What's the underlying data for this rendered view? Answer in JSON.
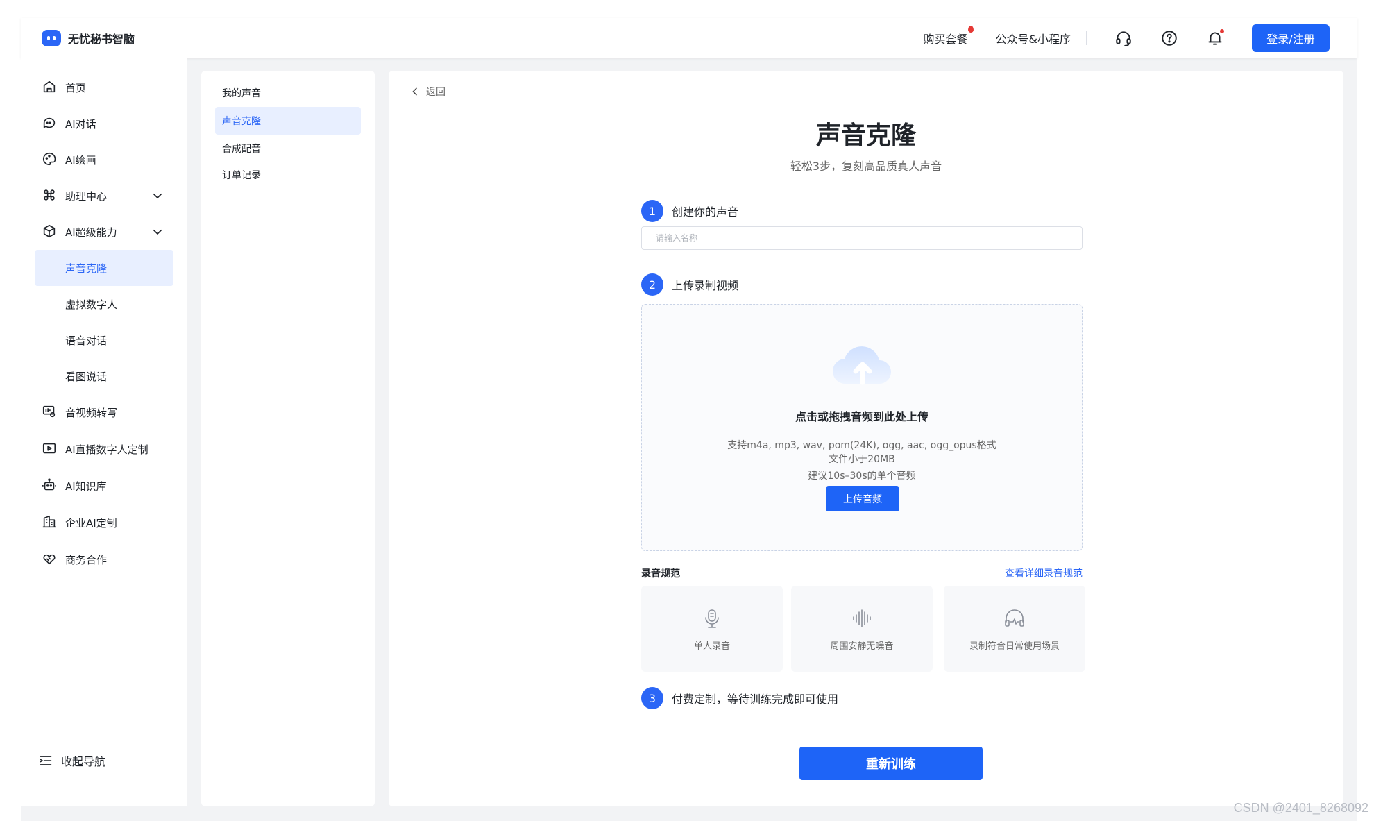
{
  "header": {
    "brand": "无忧秘书智脑",
    "links": [
      "购买套餐",
      "公众号&小程序"
    ],
    "login_label": "登录/注册"
  },
  "sidebar": {
    "items": [
      {
        "label": "首页",
        "icon": "home-icon"
      },
      {
        "label": "AI对话",
        "icon": "chat-icon"
      },
      {
        "label": "AI绘画",
        "icon": "palette-icon"
      },
      {
        "label": "助理中心",
        "icon": "command-icon"
      },
      {
        "label": "AI超级能力",
        "icon": "cube-icon"
      },
      {
        "label": "音视频转写",
        "icon": "transcribe-icon"
      },
      {
        "label": "AI直播数字人定制",
        "icon": "live-video-icon"
      },
      {
        "label": "AI知识库",
        "icon": "robot-icon"
      },
      {
        "label": "企业AI定制",
        "icon": "building-icon"
      },
      {
        "label": "商务合作",
        "icon": "handshake-icon"
      }
    ],
    "sub_items": [
      "声音克隆",
      "虚拟数字人",
      "语音对话",
      "看图说话"
    ],
    "collapse_label": "收起导航"
  },
  "subnav": {
    "items": [
      "我的声音",
      "声音克隆",
      "合成配音",
      "订单记录"
    ]
  },
  "main": {
    "back_label": "返回",
    "title": "声音克隆",
    "subtitle": "轻松3步，复刻高品质真人声音",
    "steps": [
      {
        "num": "1",
        "label": "创建你的声音"
      },
      {
        "num": "2",
        "label": "上传录制视频"
      },
      {
        "num": "3",
        "label": "付费定制，等待训练完成即可使用"
      }
    ],
    "name_placeholder": "请输入名称",
    "upload": {
      "title": "点击或拖拽音频到此处上传",
      "formats": "支持m4a, mp3, wav, pom(24K), ogg, aac, ogg_opus格式",
      "size": "文件小于20MB",
      "duration": "建议10s–30s的单个音频",
      "button": "上传音频"
    },
    "spec": {
      "label": "录音规范",
      "link": "查看详细录音规范",
      "cards": [
        {
          "label": "单人录音",
          "icon": "microphone-icon"
        },
        {
          "label": "周围安静无噪音",
          "icon": "sound-wave-icon"
        },
        {
          "label": "录制符合日常使用场景",
          "icon": "headphones-icon"
        }
      ]
    },
    "retrain_label": "重新训练"
  },
  "watermark": "CSDN @2401_8268092",
  "colors": {
    "accent": "#1e64f7",
    "active_bg": "#e8efff",
    "page_bg": "#f2f3f5"
  }
}
